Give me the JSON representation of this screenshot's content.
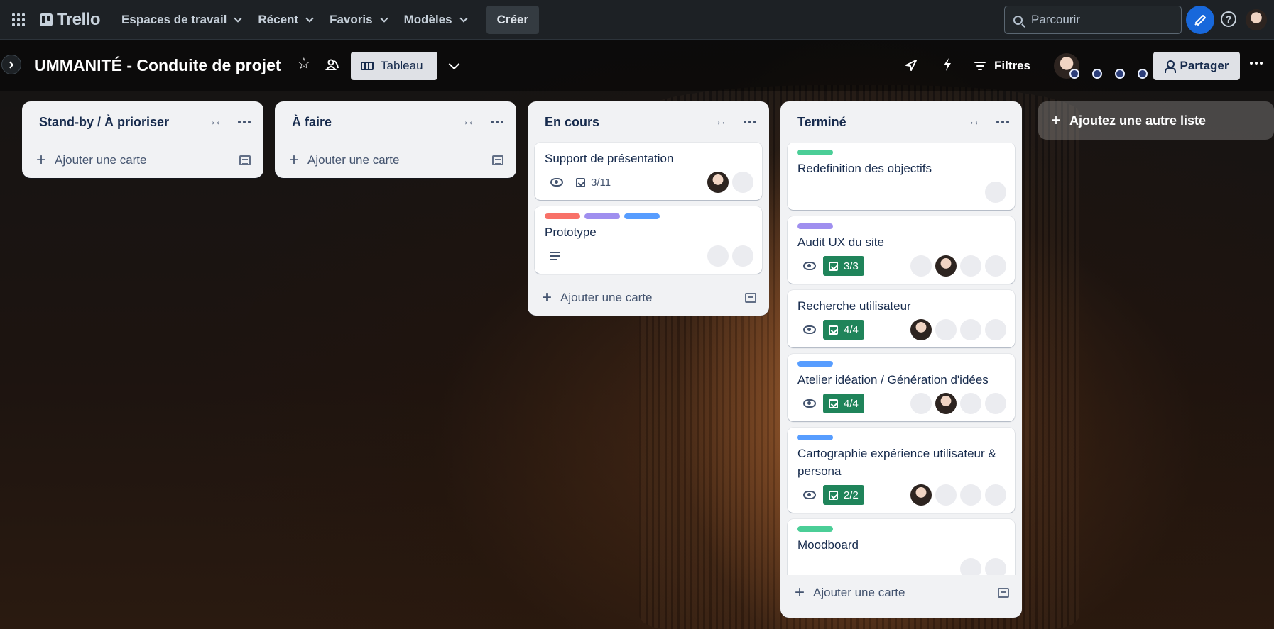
{
  "topnav": {
    "logo": "Trello",
    "menus": [
      "Espaces de travail",
      "Récent",
      "Favoris",
      "Modèles"
    ],
    "create": "Créer",
    "search_placeholder": "Parcourir"
  },
  "board": {
    "title": "UMMANITÉ - Conduite de projet",
    "view": "Tableau",
    "filters": "Filtres",
    "share": "Partager"
  },
  "colors": {
    "green": "#4bce97",
    "red": "#f87168",
    "purple": "#9f8fef",
    "blue": "#579dff",
    "done_badge": "#1f845a"
  },
  "lists": [
    {
      "title": "Stand-by / À prioriser",
      "add_card": "Ajouter une carte"
    },
    {
      "title": "À faire",
      "add_card": "Ajouter une carte"
    },
    {
      "title": "En cours",
      "add_card": "Ajouter une carte",
      "cards": [
        {
          "title": "Support de présentation",
          "checklist": "3/11"
        },
        {
          "title": "Prototype"
        }
      ]
    },
    {
      "title": "Terminé",
      "add_card": "Ajouter une carte",
      "cards": [
        {
          "title": "Redefinition des objectifs"
        },
        {
          "title": "Audit UX du site",
          "checklist": "3/3"
        },
        {
          "title": "Recherche utilisateur",
          "checklist": "4/4"
        },
        {
          "title": "Atelier idéation / Génération d'idées",
          "checklist": "4/4"
        },
        {
          "title": "Cartographie expérience utilisateur & persona",
          "checklist": "2/2"
        },
        {
          "title": "Moodboard"
        }
      ]
    }
  ],
  "add_list": "Ajoutez une autre liste"
}
